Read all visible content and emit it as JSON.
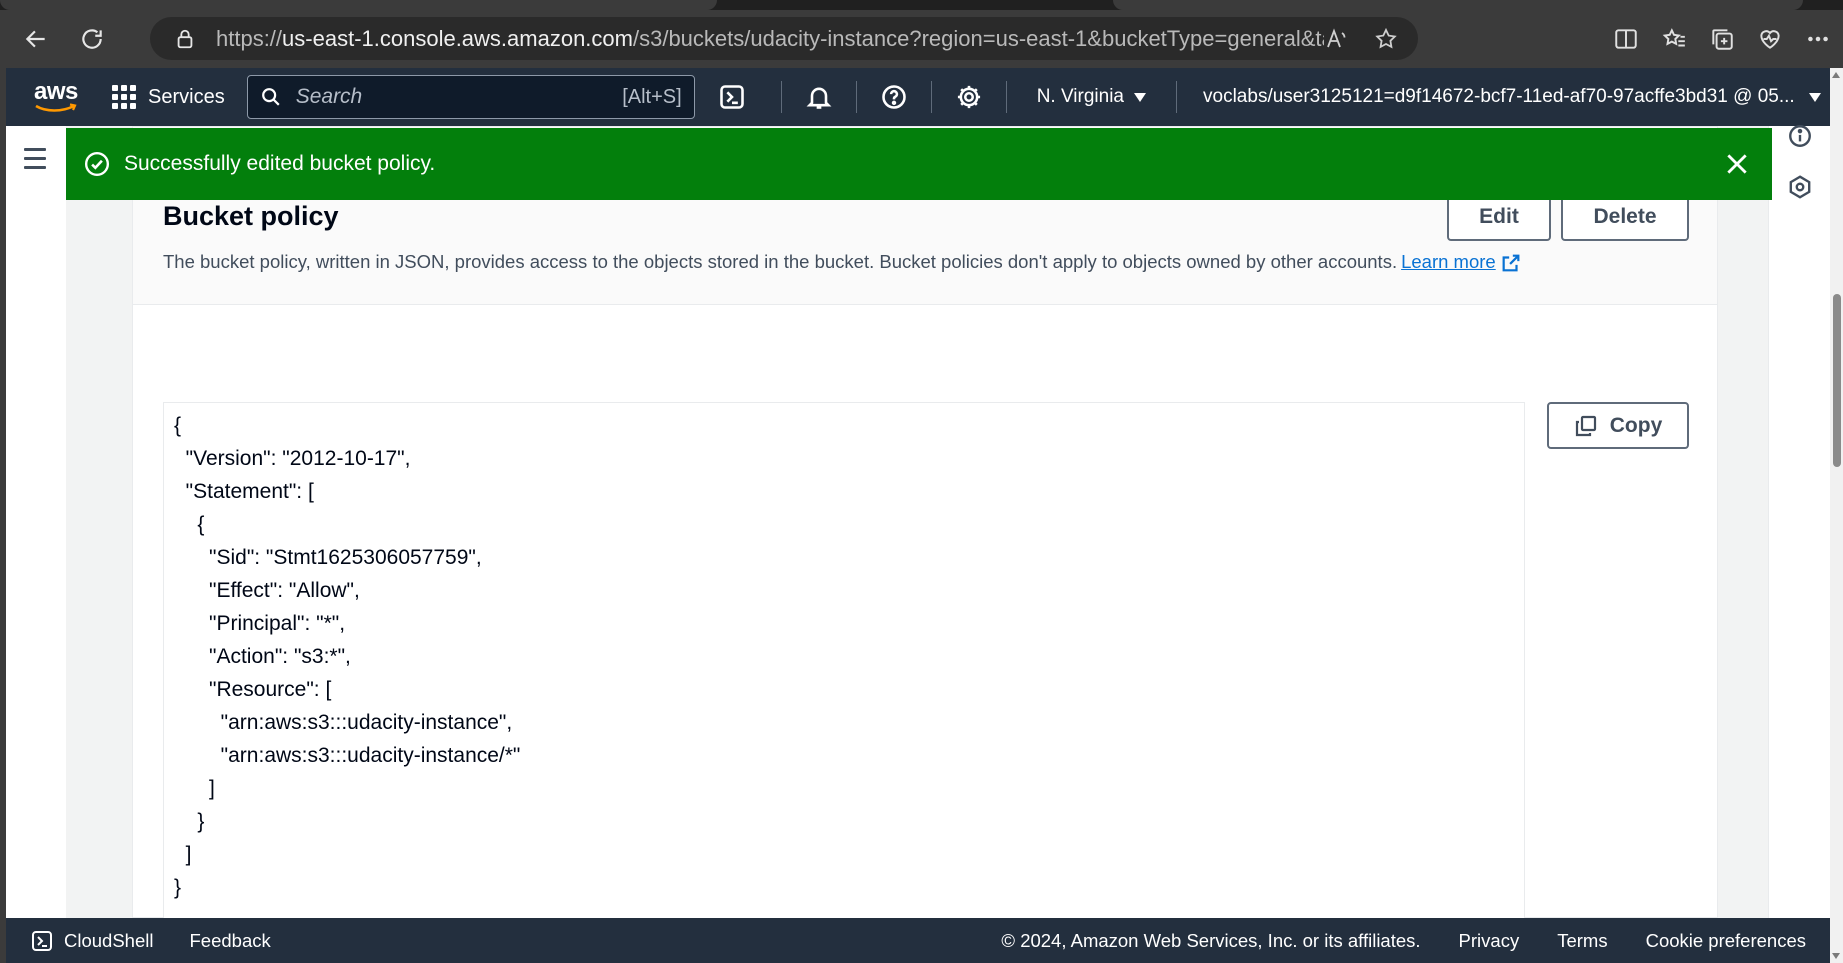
{
  "browser": {
    "url_scheme": "https://",
    "url_host": "us-east-1.console.aws.amazon.com",
    "url_path": "/s3/buckets/udacity-instance?region=us-east-1&bucketType=general&tab=perm..."
  },
  "aws_nav": {
    "logo_text": "aws",
    "services_label": "Services",
    "search_placeholder": "Search",
    "search_shortcut": "[Alt+S]",
    "region": "N. Virginia",
    "account": "voclabs/user3125121=d9f14672-bcf7-11ed-af70-97acffe3bd31 @ 05..."
  },
  "flash": {
    "message": "Successfully edited bucket policy.",
    "color": "#037f0c"
  },
  "section": {
    "title": "Bucket policy",
    "description": "The bucket policy, written in JSON, provides access to the objects stored in the bucket. Bucket policies don't apply to objects owned by other accounts.",
    "learn_more": "Learn more",
    "edit_label": "Edit",
    "delete_label": "Delete",
    "copy_label": "Copy"
  },
  "policy_lines": [
    "{",
    "  \"Version\": \"2012-10-17\",",
    "  \"Statement\": [",
    "    {",
    "      \"Sid\": \"Stmt1625306057759\",",
    "      \"Effect\": \"Allow\",",
    "      \"Principal\": \"*\",",
    "      \"Action\": \"s3:*\",",
    "      \"Resource\": [",
    "        \"arn:aws:s3:::udacity-instance\",",
    "        \"arn:aws:s3:::udacity-instance/*\"",
    "      ]",
    "    }",
    "  ]",
    "}"
  ],
  "footer": {
    "cloudshell": "CloudShell",
    "feedback": "Feedback",
    "copyright": "© 2024, Amazon Web Services, Inc. or its affiliates.",
    "privacy": "Privacy",
    "terms": "Terms",
    "cookies": "Cookie preferences"
  },
  "colors": {
    "aws_nav": "#232f3e",
    "link": "#0972d3",
    "aws_orange": "#ff9900"
  }
}
